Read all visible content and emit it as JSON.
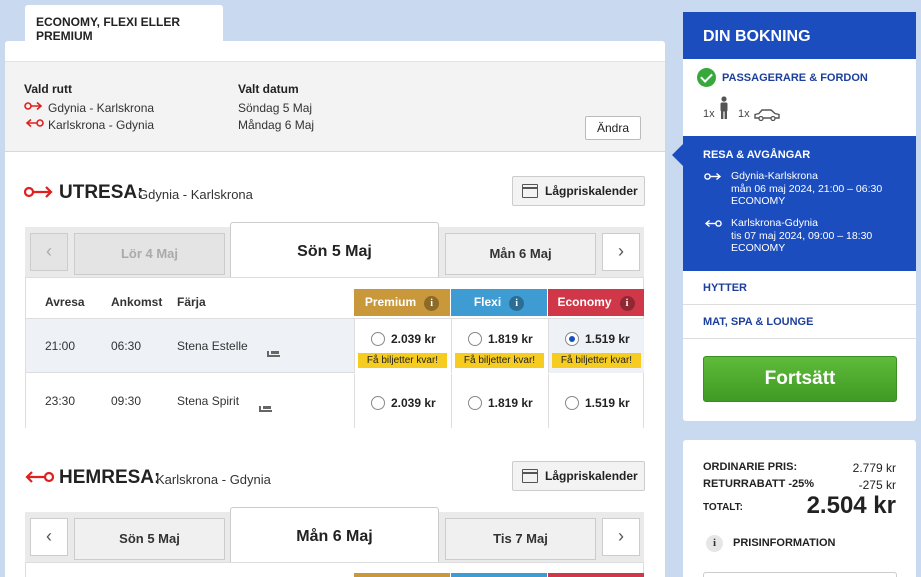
{
  "tab_label": "ECONOMY, FLEXI ELLER PREMIUM",
  "route": {
    "vald_rutt_label": "Vald rutt",
    "valt_datum_label": "Valt datum",
    "out_route": "Gdynia - Karlskrona",
    "ret_route": "Karlskrona - Gdynia",
    "out_date": "Söndag 5 Maj",
    "ret_date": "Måndag 6 Maj",
    "change_button": "Ändra"
  },
  "utresa": {
    "title": "UTRESA:",
    "route": "Gdynia - Karlskrona",
    "calendar_button": "Lågpriskalender",
    "prev_date": "Lör 4 Maj",
    "active_date": "Sön 5 Maj",
    "next_date": "Mån 6 Maj",
    "prev_arrow": "‹",
    "next_arrow": "›",
    "columns": {
      "avresa": "Avresa",
      "ankomst": "Ankomst",
      "farja": "Färja"
    },
    "fares": [
      {
        "name": "Premium",
        "color": "#c9983a"
      },
      {
        "name": "Flexi",
        "color": "#3f9cd3"
      },
      {
        "name": "Economy",
        "color": "#d0384a"
      }
    ],
    "info_glyph": "i",
    "rows": [
      {
        "avresa": "21:00",
        "ankomst": "06:30",
        "farja": "Stena Estelle",
        "premium": "2.039 kr",
        "flexi": "1.819 kr",
        "economy": "1.519 kr",
        "few_left": "Få biljetter kvar!",
        "selected": "economy"
      },
      {
        "avresa": "23:30",
        "ankomst": "09:30",
        "farja": "Stena Spirit",
        "premium": "2.039 kr",
        "flexi": "1.819 kr",
        "economy": "1.519 kr",
        "few_left": "",
        "selected": ""
      }
    ]
  },
  "hemresa": {
    "title": "HEMRESA:",
    "route": "Karlskrona - Gdynia",
    "calendar_button": "Lågpriskalender",
    "prev_date": "Sön 5 Maj",
    "active_date": "Mån 6 Maj",
    "next_date": "Tis 7 Maj",
    "prev_arrow": "‹",
    "next_arrow": "›"
  },
  "sidebar": {
    "title": "DIN BOKNING",
    "passengers_label": "PASSAGERARE & FORDON",
    "person_count": "1x",
    "car_count": "1x",
    "resa_label": "RESA & AVGÅNGAR",
    "out_leg": {
      "route": "Gdynia-Karlskrona",
      "time": "mån 06 maj 2024, 21:00 – 06:30",
      "class": "ECONOMY"
    },
    "ret_leg": {
      "route": "Karlskrona-Gdynia",
      "time": "tis 07 maj 2024, 09:00 – 18:30",
      "class": "ECONOMY"
    },
    "hytter": "HYTTER",
    "mat": "MAT, SPA & LOUNGE",
    "continue_button": "Fortsätt",
    "accent": "#1c4dbf"
  },
  "price": {
    "ordinarie_label": "ORDINARIE PRIS:",
    "ordinarie_value": "2.779 kr",
    "rabatt_label": "RETURRABATT -25%",
    "rabatt_value": "-275 kr",
    "total_label": "TOTALT:",
    "total_value": "2.504 kr",
    "info_label": "PRISINFORMATION",
    "info_glyph": "i"
  }
}
